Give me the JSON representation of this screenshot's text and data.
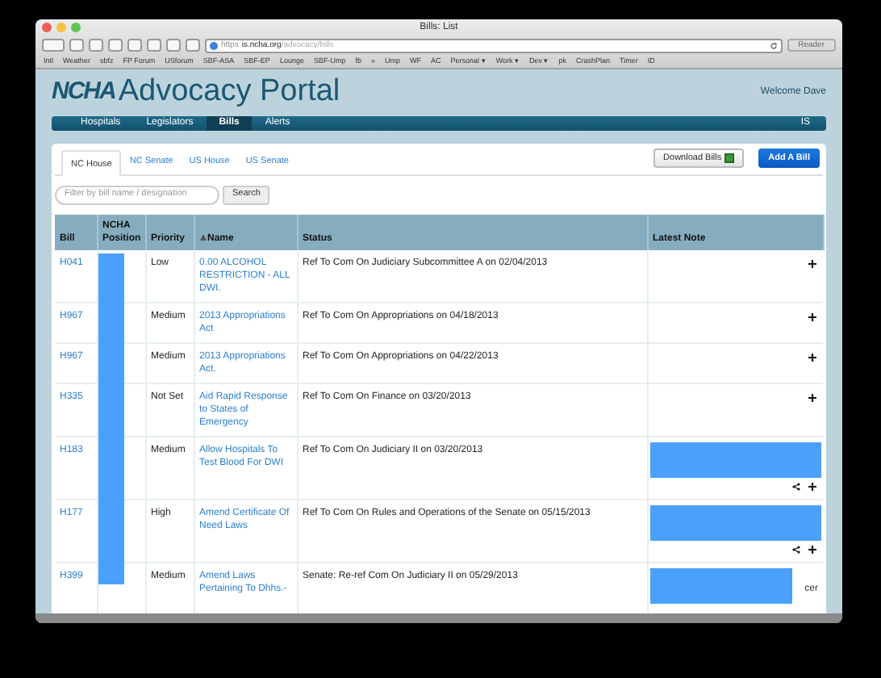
{
  "window": {
    "title": "Bills: List"
  },
  "browser": {
    "scheme": "https",
    "host": "is.ncha.org",
    "path": "/advocacy/bills",
    "reader": "Reader",
    "bookmarks": [
      "Intl",
      "Weather",
      "sbfz",
      "FP Forum",
      "USforum",
      "SBF-ASA",
      "SBF-EP",
      "Lounge",
      "SBF-Ump",
      "fb",
      "»",
      "Ump",
      "WF",
      "AC",
      "Personal ▾",
      "Work ▾",
      "Dev ▾",
      "pk",
      "CrashPlan",
      "Timer",
      "ID"
    ]
  },
  "header": {
    "logo": "NCHA",
    "title": "Advocacy Portal",
    "welcome": "Welcome Dave"
  },
  "nav": {
    "items": [
      {
        "label": "Hospitals",
        "selected": false
      },
      {
        "label": "Legislators",
        "selected": false
      },
      {
        "label": "Bills",
        "selected": true
      },
      {
        "label": "Alerts",
        "selected": false
      }
    ],
    "user": "IS"
  },
  "tabs": [
    {
      "label": "NC House",
      "selected": true
    },
    {
      "label": "NC Senate",
      "selected": false
    },
    {
      "label": "US House",
      "selected": false
    },
    {
      "label": "US Senate",
      "selected": false
    }
  ],
  "buttons": {
    "download": "Download Bills",
    "add": "Add A Bill"
  },
  "filter": {
    "placeholder": "Filter by bill name / designation",
    "button": "Search"
  },
  "table": {
    "columns": [
      {
        "label": "Bill",
        "sorted": false
      },
      {
        "label": "NCHA Position",
        "sorted": false
      },
      {
        "label": "Priority",
        "sorted": false
      },
      {
        "label": "Name",
        "sorted": true
      },
      {
        "label": "Status",
        "sorted": false
      },
      {
        "label": "Latest Note",
        "sorted": false
      }
    ],
    "position_redacted": true,
    "rows": [
      {
        "bill": "H041",
        "priority": "Low",
        "name": "0.00 ALCOHOL RESTRICTION - ALL DWI.",
        "status": "Ref To Com On Judiciary Subcommittee A on 02/04/2013",
        "note_redacted": false,
        "share": false
      },
      {
        "bill": "H967",
        "priority": "Medium",
        "name": "2013 Appropriations Act",
        "status": "Ref To Com On Appropriations on 04/18/2013",
        "note_redacted": false,
        "share": false
      },
      {
        "bill": "H967",
        "priority": "Medium",
        "name": "2013 Appropriations Act.",
        "status": "Ref To Com On Appropriations on 04/22/2013",
        "note_redacted": false,
        "share": false
      },
      {
        "bill": "H335",
        "priority": "Not Set",
        "name": "Aid Rapid Response to States of Emergency",
        "status": "Ref To Com On Finance on 03/20/2013",
        "note_redacted": false,
        "share": false
      },
      {
        "bill": "H183",
        "priority": "Medium",
        "name": "Allow Hospitals To Test Blood For DWI",
        "status": "Ref To Com On Judiciary II on 03/20/2013",
        "note_redacted": true,
        "share": true
      },
      {
        "bill": "H177",
        "priority": "High",
        "name": "Amend Certificate Of Need Laws",
        "status": "Ref To Com On Rules and Operations of the Senate on 05/15/2013",
        "note_redacted": true,
        "share": true
      },
      {
        "bill": "H399",
        "priority": "Medium",
        "name": "Amend Laws Pertaining To Dhhs.-",
        "status": "Senate: Re-ref Com On Judiciary II on 05/29/2013",
        "note_redacted": true,
        "share": false,
        "note_tail": "cer"
      }
    ]
  }
}
